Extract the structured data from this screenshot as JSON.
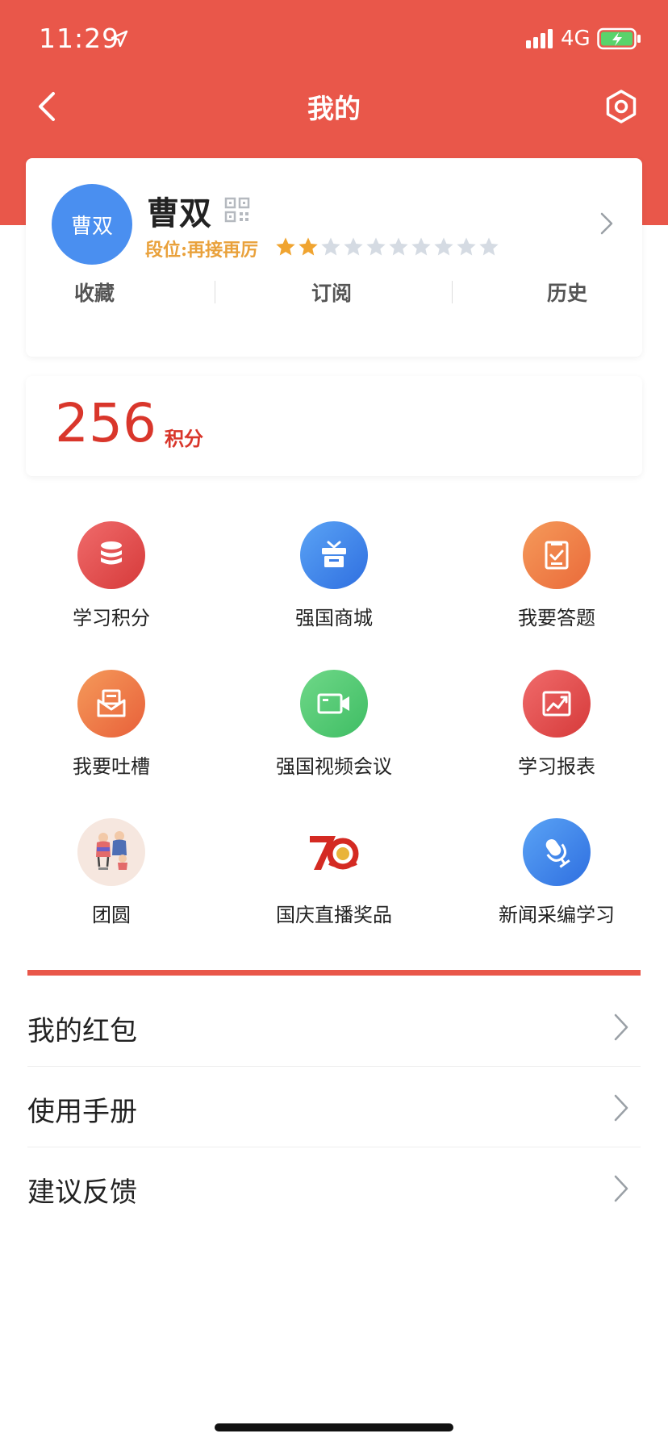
{
  "status_bar": {
    "time": "11:29",
    "network": "4G"
  },
  "nav": {
    "title": "我的"
  },
  "profile": {
    "avatar_text": "曹双",
    "name": "曹双",
    "rank_label": "段位:再接再厉",
    "stars_filled": 2,
    "stars_total": 10,
    "quick_links": [
      {
        "label": "收藏"
      },
      {
        "label": "订阅"
      },
      {
        "label": "历史"
      }
    ]
  },
  "points": {
    "value": "256",
    "unit": "积分"
  },
  "grid": [
    {
      "label": "学习积分",
      "icon": "database-icon"
    },
    {
      "label": "强国商城",
      "icon": "tv-box-icon"
    },
    {
      "label": "我要答题",
      "icon": "clipboard-check-icon"
    },
    {
      "label": "我要吐槽",
      "icon": "mail-icon"
    },
    {
      "label": "强国视频会议",
      "icon": "video-camera-icon"
    },
    {
      "label": "学习报表",
      "icon": "chart-icon"
    },
    {
      "label": "团圆",
      "icon": "family-illustration-icon"
    },
    {
      "label": "国庆直播奖品",
      "icon": "anniversary-70-icon"
    },
    {
      "label": "新闻采编学习",
      "icon": "microphone-icon"
    }
  ],
  "menu": [
    {
      "label": "我的红包"
    },
    {
      "label": "使用手册"
    },
    {
      "label": "建议反馈"
    }
  ],
  "colors": {
    "brand_red": "#e9574a",
    "points_red": "#d9362b",
    "rank_orange": "#e9a13b",
    "star_filled": "#f0a430",
    "star_empty": "#d5dbe3",
    "avatar_blue": "#4a8ff0"
  }
}
